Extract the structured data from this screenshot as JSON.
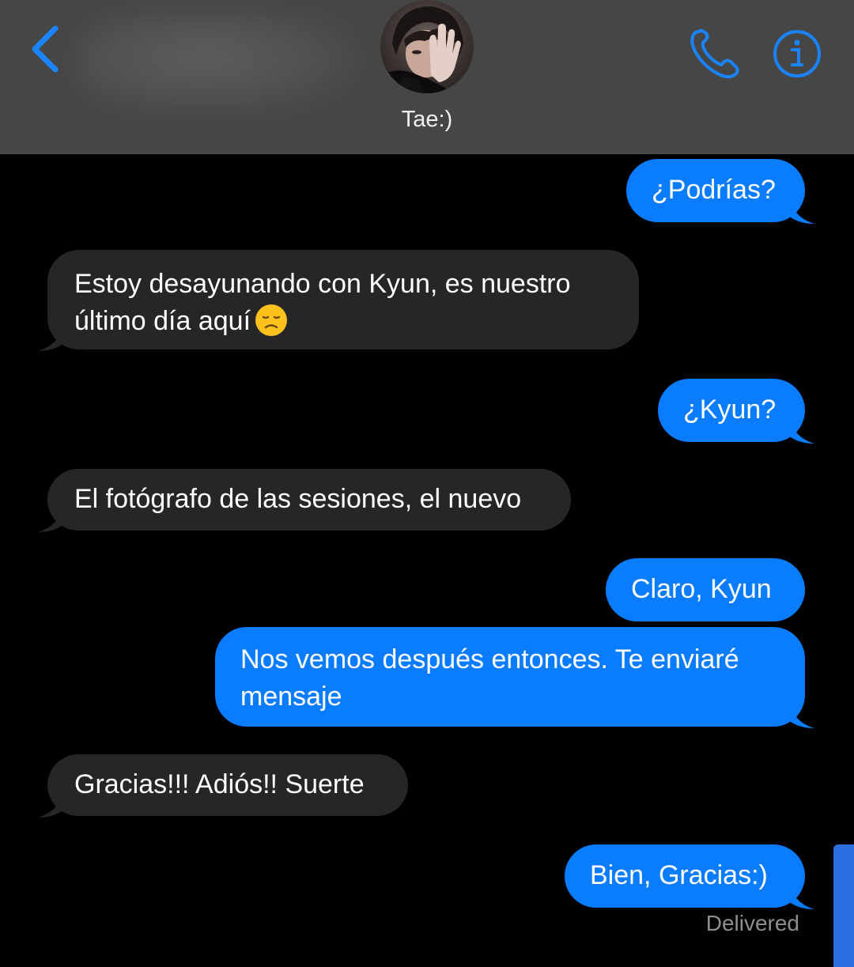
{
  "header": {
    "contact_name": "Tae:)",
    "back_icon": "chevron-left-icon",
    "call_icon": "phone-icon",
    "info_icon": "info-icon",
    "accent_color": "#0a7cff",
    "background_color": "#464646"
  },
  "messages": [
    {
      "direction": "outgoing",
      "text": "¿Podrías?"
    },
    {
      "direction": "incoming",
      "text": "Estoy desayunando con Kyun, es nuestro\núltimo día aquí",
      "emoji": "disappointed-face-emoji"
    },
    {
      "direction": "outgoing",
      "text": "¿Kyun?"
    },
    {
      "direction": "incoming",
      "text": "El fotógrafo de las sesiones, el nuevo"
    },
    {
      "direction": "outgoing",
      "text": "Claro, Kyun"
    },
    {
      "direction": "outgoing",
      "text": "Nos vemos después entonces. Te enviaré\nmensaje"
    },
    {
      "direction": "incoming",
      "text": "Gracias!!! Adiós!! Suerte"
    },
    {
      "direction": "outgoing",
      "text": "Bien, Gracias:)"
    }
  ],
  "status": {
    "delivered_label": "Delivered"
  },
  "colors": {
    "outgoing_bubble": "#0a7cff",
    "incoming_bubble": "#262628",
    "chat_background": "#000000"
  }
}
